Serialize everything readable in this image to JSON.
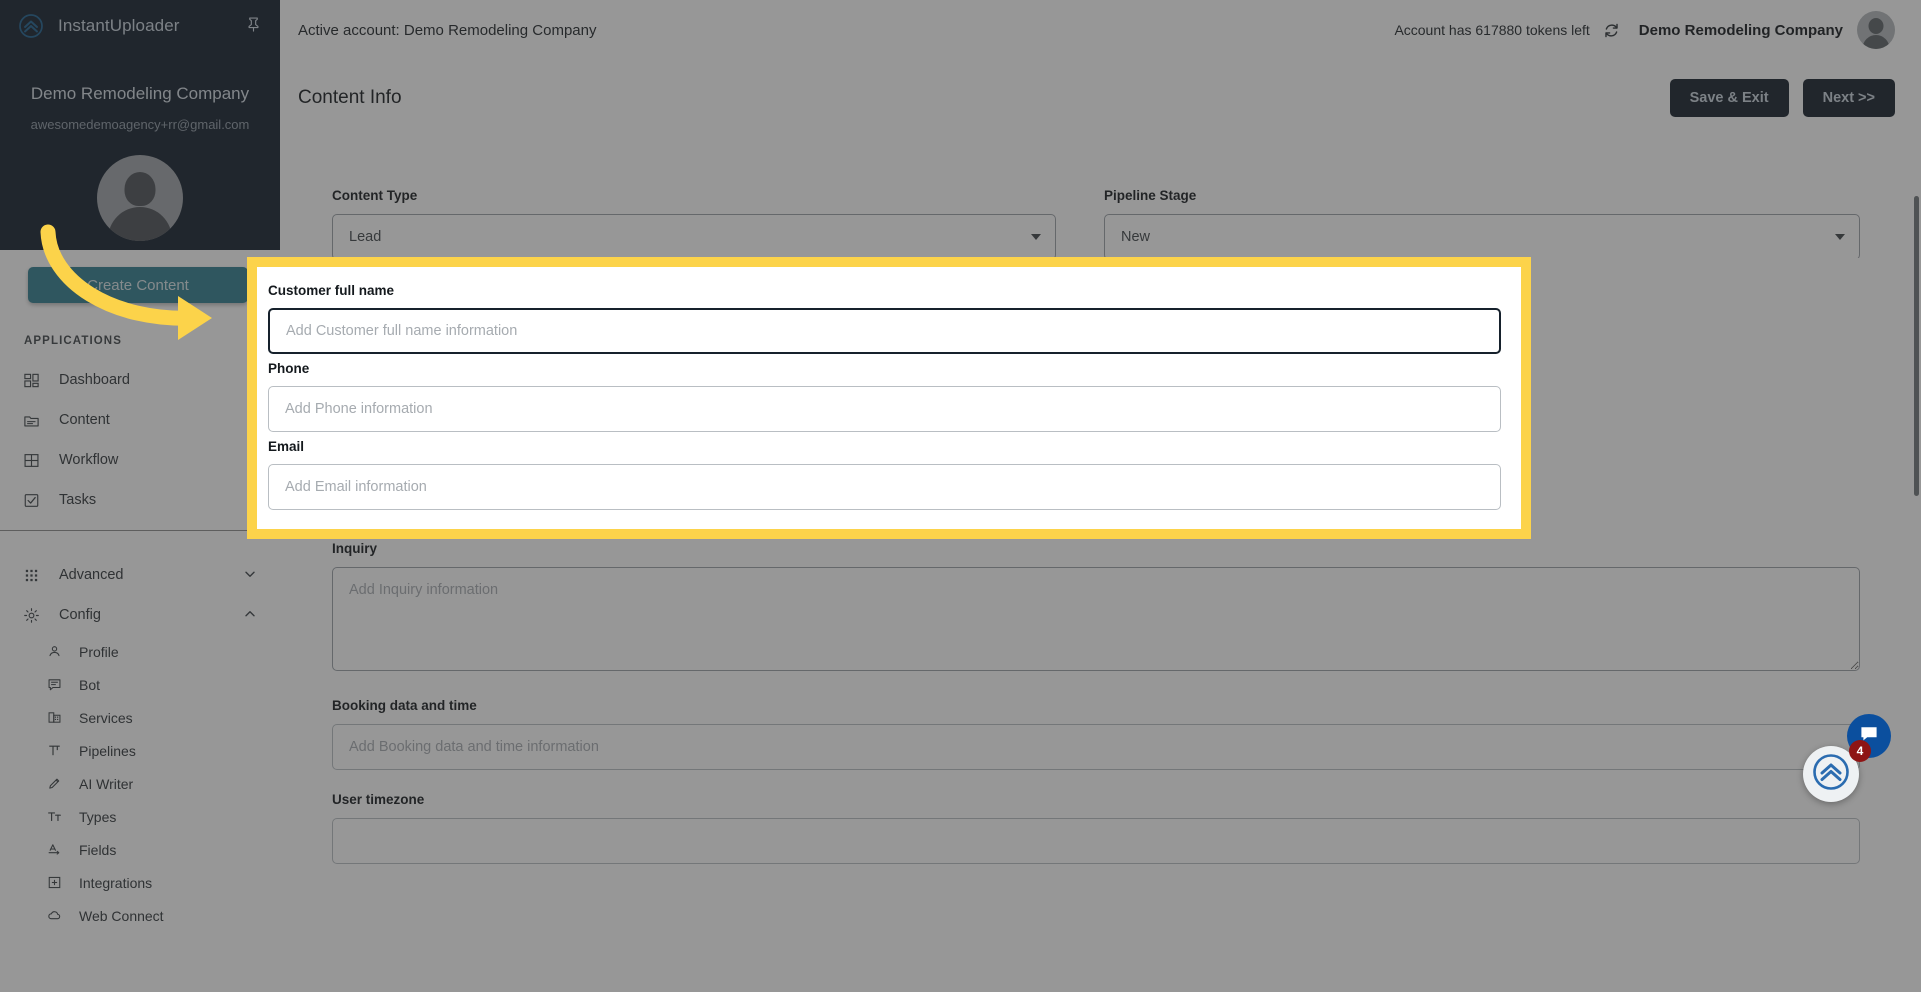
{
  "brand": {
    "name": "InstantUploader",
    "logo_icon": "double-chevron-up-circle-icon",
    "pin_icon": "pin-icon"
  },
  "sidebar": {
    "account_name": "Demo Remodeling Company",
    "account_email": "awesomedemoagency+rr@gmail.com",
    "avatar_icon": "user-avatar-placeholder",
    "create_button": "Create Content",
    "section_label": "APPLICATIONS",
    "applications": [
      {
        "label": "Dashboard",
        "icon": "dashboard-grid-icon"
      },
      {
        "label": "Content",
        "icon": "folder-icon"
      },
      {
        "label": "Workflow",
        "icon": "table-grid-icon"
      },
      {
        "label": "Tasks",
        "icon": "checkbox-icon"
      }
    ],
    "groups": [
      {
        "label": "Advanced",
        "icon": "apps-dots-icon",
        "expanded": false,
        "chevron": "chevron-down-icon"
      },
      {
        "label": "Config",
        "icon": "gear-icon",
        "expanded": true,
        "chevron": "chevron-up-icon"
      }
    ],
    "config_items": [
      {
        "label": "Profile",
        "icon": "person-icon"
      },
      {
        "label": "Bot",
        "icon": "chat-lines-icon"
      },
      {
        "label": "Services",
        "icon": "building-icon"
      },
      {
        "label": "Pipelines",
        "icon": "pipeline-icon"
      },
      {
        "label": "AI Writer",
        "icon": "pencil-icon"
      },
      {
        "label": "Types",
        "icon": "text-format-icon"
      },
      {
        "label": "Fields",
        "icon": "field-label-icon"
      },
      {
        "label": "Integrations",
        "icon": "plus-box-icon"
      },
      {
        "label": "Web Connect",
        "icon": "cloud-icon"
      }
    ]
  },
  "topbar": {
    "active_account": "Active account: Demo Remodeling Company",
    "tokens_text": "Account has 617880 tokens left",
    "refresh_icon": "refresh-icon",
    "account_name": "Demo Remodeling Company",
    "avatar_icon": "user-avatar-placeholder"
  },
  "page": {
    "title": "Content Info",
    "save_exit_label": "Save & Exit",
    "next_label": "Next >>"
  },
  "form": {
    "content_type": {
      "label": "Content Type",
      "value": "Lead",
      "caret_icon": "caret-down-icon"
    },
    "pipeline_stage": {
      "label": "Pipeline Stage",
      "value": "New",
      "caret_icon": "caret-down-icon"
    },
    "highlighted_fields": [
      {
        "label": "Customer full name",
        "placeholder": "Add Customer full name information",
        "value": "",
        "focused": true
      },
      {
        "label": "Phone",
        "placeholder": "Add Phone information",
        "value": "",
        "focused": false
      },
      {
        "label": "Email",
        "placeholder": "Add Email information",
        "value": "",
        "focused": false
      }
    ],
    "other_fields": [
      {
        "label": "Inquiry",
        "placeholder": "Add Inquiry information",
        "value": "",
        "type": "textarea"
      },
      {
        "label": "Booking data and time",
        "placeholder": "Add Booking data and time information",
        "value": "",
        "type": "text"
      },
      {
        "label": "User timezone",
        "placeholder": "",
        "value": "",
        "type": "text"
      }
    ]
  },
  "widgets": {
    "chat_icon": "chat-bubble-icon",
    "launcher_icon": "double-chevron-up-circle-icon",
    "launcher_badge": "4"
  },
  "colors": {
    "sidebar_dark": "#111d2b",
    "accent_teal": "#2e7d8e",
    "button_dark": "#121d29",
    "highlight_yellow": "#fcd34a",
    "chat_blue": "#0b4f9e",
    "badge_red": "#8e1414"
  }
}
